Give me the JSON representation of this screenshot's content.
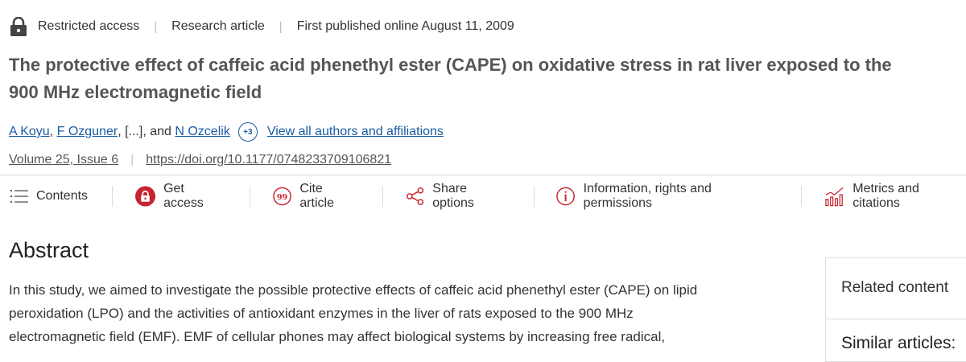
{
  "meta": {
    "access": "Restricted access",
    "type": "Research article",
    "published": "First published online August 11, 2009"
  },
  "title": "The protective effect of caffeic acid phenethyl ester (CAPE) on oxidative stress in rat liver exposed to the 900 MHz electromagnetic field",
  "authors": {
    "a1": "A Koyu",
    "comma": ",",
    "a2": "F Ozguner",
    "ellipsis_text": ", [...], and",
    "a3": "N Ozcelik",
    "more_badge": "+3",
    "view_all": "View all authors and affiliations"
  },
  "publication": {
    "volume": "Volume 25, Issue 6",
    "doi": "https://doi.org/10.1177/0748233709106821"
  },
  "toolbar": {
    "contents": "Contents",
    "get_access": "Get access",
    "cite": "Cite article",
    "share": "Share options",
    "info": "Information, rights and permissions",
    "metrics": "Metrics and citations"
  },
  "abstract": {
    "heading": "Abstract",
    "text": "In this study, we aimed to investigate the possible protective effects of caffeic acid phenethyl ester (CAPE) on lipid peroxidation (LPO) and the activities of antioxidant enzymes in the liver of rats exposed to the 900 MHz electromagnetic field (EMF). EMF of cellular phones may affect biological systems by increasing free radical,"
  },
  "sidebar": {
    "related": "Related content",
    "similar": "Similar articles:"
  },
  "colors": {
    "link": "#1a5ba5",
    "accent_red": "#c8242f",
    "text": "#333333"
  },
  "icons": [
    "lock-icon",
    "contents-icon",
    "get-access-lock-icon",
    "cite-icon",
    "share-icon",
    "info-icon",
    "metrics-icon"
  ]
}
